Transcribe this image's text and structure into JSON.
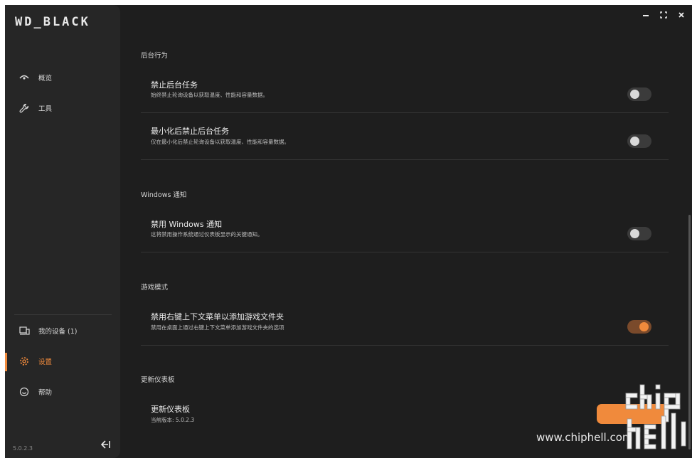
{
  "brand": {
    "logo_text": "WD_BLACK",
    "accent": "#f08a3c"
  },
  "window_controls": {
    "minimize": "minimize-icon",
    "maximize": "maximize-icon",
    "close": "close-icon"
  },
  "sidebar": {
    "top_items": [
      {
        "label": "概览",
        "icon": "eye-icon"
      },
      {
        "label": "工具",
        "icon": "wrench-icon"
      }
    ],
    "bottom_items": [
      {
        "label": "我的设备 (1)",
        "icon": "devices-icon"
      },
      {
        "label": "设置",
        "icon": "gear-icon",
        "active": true
      },
      {
        "label": "帮助",
        "icon": "help-icon"
      }
    ],
    "version": "5.0.2.3"
  },
  "sections": {
    "background": {
      "title": "后台行为",
      "rows": [
        {
          "title": "禁止后台任务",
          "desc": "始终禁止轮询设备以获取温度、性能和容量数据。",
          "toggle_on": false
        },
        {
          "title": "最小化后禁止后台任务",
          "desc": "仅在最小化后禁止轮询设备以获取温度、性能和容量数据。",
          "toggle_on": false
        }
      ]
    },
    "windows": {
      "title": "Windows 通知",
      "rows": [
        {
          "title": "禁用 Windows 通知",
          "desc": "这将禁用操作系统通过仪表板显示的关键通知。",
          "toggle_on": false
        }
      ]
    },
    "game": {
      "title": "游戏模式",
      "rows": [
        {
          "title": "禁用右键上下文菜单以添加游戏文件夹",
          "desc": "禁用在桌面上通过右键上下文菜单添加游戏文件夹的选项",
          "toggle_on": true
        }
      ]
    },
    "update": {
      "title": "更新仪表板",
      "row_title": "更新仪表板",
      "current_version": "当前版本: 5.0.2.3"
    }
  },
  "watermark": {
    "url": "www.chiphell.com"
  }
}
